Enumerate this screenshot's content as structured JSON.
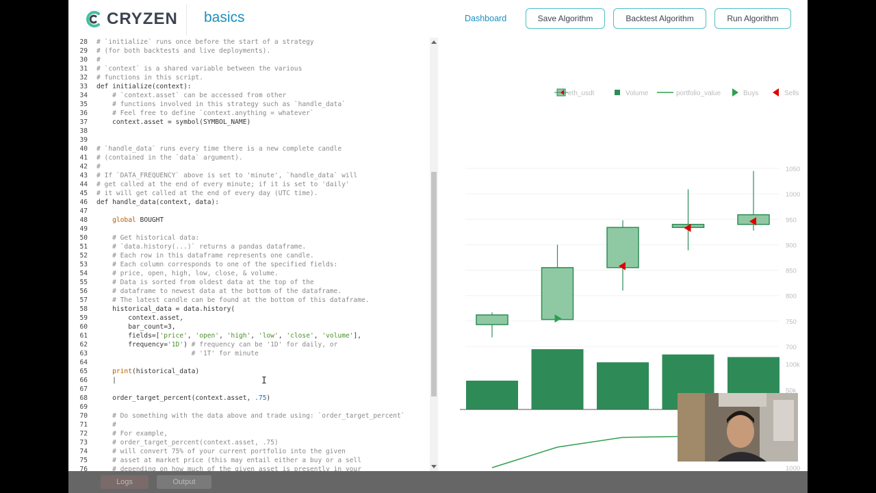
{
  "app": {
    "logo_text": "CRYZEN",
    "project_name": "basics"
  },
  "nav": {
    "dashboard_label": "Dashboard",
    "save_label": "Save Algorithm",
    "backtest_label": "Backtest Algorithm",
    "run_label": "Run Algorithm"
  },
  "editor": {
    "lines": [
      {
        "n": "28",
        "t": "# `initialize` runs once before the start of a strategy",
        "k": "c"
      },
      {
        "n": "29",
        "t": "# (for both backtests and live deployments).",
        "k": "c"
      },
      {
        "n": "30",
        "t": "#",
        "k": "c"
      },
      {
        "n": "31",
        "t": "# `context` is a shared variable between the various",
        "k": "c"
      },
      {
        "n": "32",
        "t": "# functions in this script.",
        "k": "c"
      },
      {
        "n": "33",
        "t": "def initialize(context):",
        "k": "def"
      },
      {
        "n": "34",
        "t": "    # `context.asset` can be accessed from other",
        "k": "c"
      },
      {
        "n": "35",
        "t": "    # functions involved in this strategy such as `handle_data`",
        "k": "c"
      },
      {
        "n": "36",
        "t": "    # Feel free to define `context.anything = whatever`",
        "k": "c"
      },
      {
        "n": "37",
        "t": "    context.asset = symbol(SYMBOL_NAME)",
        "k": "p"
      },
      {
        "n": "38",
        "t": "",
        "k": "p"
      },
      {
        "n": "39",
        "t": "",
        "k": "p"
      },
      {
        "n": "40",
        "t": "# `handle_data` runs every time there is a new complete candle",
        "k": "c"
      },
      {
        "n": "41",
        "t": "# (contained in the `data` argument).",
        "k": "c"
      },
      {
        "n": "42",
        "t": "#",
        "k": "c"
      },
      {
        "n": "43",
        "t": "# If `DATA_FREQUENCY` above is set to 'minute', `handle_data` will",
        "k": "c"
      },
      {
        "n": "44",
        "t": "# get called at the end of every minute; if it is set to 'daily'",
        "k": "c"
      },
      {
        "n": "45",
        "t": "# it will get called at the end of every day (UTC time).",
        "k": "c"
      },
      {
        "n": "46",
        "t": "def handle_data(context, data):",
        "k": "def"
      },
      {
        "n": "47",
        "t": "",
        "k": "p"
      },
      {
        "n": "48",
        "t": "    global BOUGHT",
        "k": "global"
      },
      {
        "n": "49",
        "t": "",
        "k": "p"
      },
      {
        "n": "50",
        "t": "    # Get historical data:",
        "k": "c"
      },
      {
        "n": "51",
        "t": "    # `data.history(...)` returns a pandas dataframe.",
        "k": "c"
      },
      {
        "n": "52",
        "t": "    # Each row in this dataframe represents one candle.",
        "k": "c"
      },
      {
        "n": "53",
        "t": "    # Each column corresponds to one of the specified fields:",
        "k": "c"
      },
      {
        "n": "54",
        "t": "    # price, open, high, low, close, & volume.",
        "k": "c"
      },
      {
        "n": "55",
        "t": "    # Data is sorted from oldest data at the top of the",
        "k": "c"
      },
      {
        "n": "56",
        "t": "    # dataframe to newest data at the bottom of the dataframe.",
        "k": "c"
      },
      {
        "n": "57",
        "t": "    # The latest candle can be found at the bottom of this dataframe.",
        "k": "c"
      },
      {
        "n": "58",
        "t": "    historical_data = data.history(",
        "k": "p"
      },
      {
        "n": "59",
        "t": "        context.asset,",
        "k": "p"
      },
      {
        "n": "60",
        "t": "        bar_count=3,",
        "k": "p"
      },
      {
        "n": "61",
        "t": "        fields=['price', 'open', 'high', 'low', 'close', 'volume'],",
        "k": "fields"
      },
      {
        "n": "62",
        "t": "        frequency='1D') # frequency can be '1D' for daily, or",
        "k": "freq"
      },
      {
        "n": "63",
        "t": "                        # '1T' for minute",
        "k": "c"
      },
      {
        "n": "64",
        "t": "",
        "k": "p"
      },
      {
        "n": "65",
        "t": "    print(historical_data)",
        "k": "print"
      },
      {
        "n": "66",
        "t": "    |",
        "k": "p"
      },
      {
        "n": "67",
        "t": "",
        "k": "p"
      },
      {
        "n": "68",
        "t": "    order_target_percent(context.asset, .75)",
        "k": "otp"
      },
      {
        "n": "69",
        "t": "",
        "k": "p"
      },
      {
        "n": "70",
        "t": "    # Do something with the data above and trade using: `order_target_percent`",
        "k": "c"
      },
      {
        "n": "71",
        "t": "    #",
        "k": "c"
      },
      {
        "n": "72",
        "t": "    # For example,",
        "k": "c"
      },
      {
        "n": "73",
        "t": "    # order_target_percent(context.asset, .75)",
        "k": "c"
      },
      {
        "n": "74",
        "t": "    # will convert 75% of your current portfolio into the given",
        "k": "c"
      },
      {
        "n": "75",
        "t": "    # asset at market price (this may entail either a buy or a sell",
        "k": "c"
      },
      {
        "n": "76",
        "t": "    # depending on how much of the given asset is presently in your",
        "k": "c"
      }
    ]
  },
  "chart_data": {
    "type": "candlestick",
    "legend": [
      "eth_usdt",
      "Volume",
      "portfolio_value",
      "Buys",
      "Sells"
    ],
    "legend_placement": "top-right",
    "colors": {
      "candle": "#8fc9a3",
      "candle_border": "#2e8b57",
      "volume": "#2e8b57",
      "line": "#2e9e4f",
      "buy": "#2e9e4f",
      "sell": "#e00000"
    },
    "price_axis": {
      "ticks": [
        "1050",
        "1000",
        "950",
        "900",
        "850",
        "800",
        "750",
        "700"
      ],
      "range": [
        700,
        1050
      ]
    },
    "volume_axis": {
      "ticks": [
        "100k",
        "50k"
      ],
      "range": [
        0,
        110000
      ]
    },
    "portfolio_axis": {
      "ticks": [
        "1000"
      ]
    },
    "candles": [
      {
        "open": 743,
        "close": 762,
        "high": 767,
        "low": 718
      },
      {
        "open": 753,
        "close": 855,
        "high": 900,
        "low": 753
      },
      {
        "open": 855,
        "close": 934,
        "high": 948,
        "low": 810
      },
      {
        "open": 934,
        "close": 940,
        "high": 1009,
        "low": 889
      },
      {
        "open": 940,
        "close": 959,
        "high": 1045,
        "low": 928
      }
    ],
    "volumes": [
      55000,
      115000,
      90000,
      105000,
      100000
    ],
    "buys": [
      {
        "candle": 1,
        "price": 755
      }
    ],
    "sells": [
      {
        "candle": 2,
        "price": 858
      },
      {
        "candle": 3,
        "price": 933
      },
      {
        "candle": 4,
        "price": 946
      }
    ],
    "portfolio_values": [
      0.0,
      0.42,
      0.62,
      0.64,
      0.65
    ]
  },
  "footer": {
    "logs_label": "Logs",
    "output_label": "Output"
  }
}
